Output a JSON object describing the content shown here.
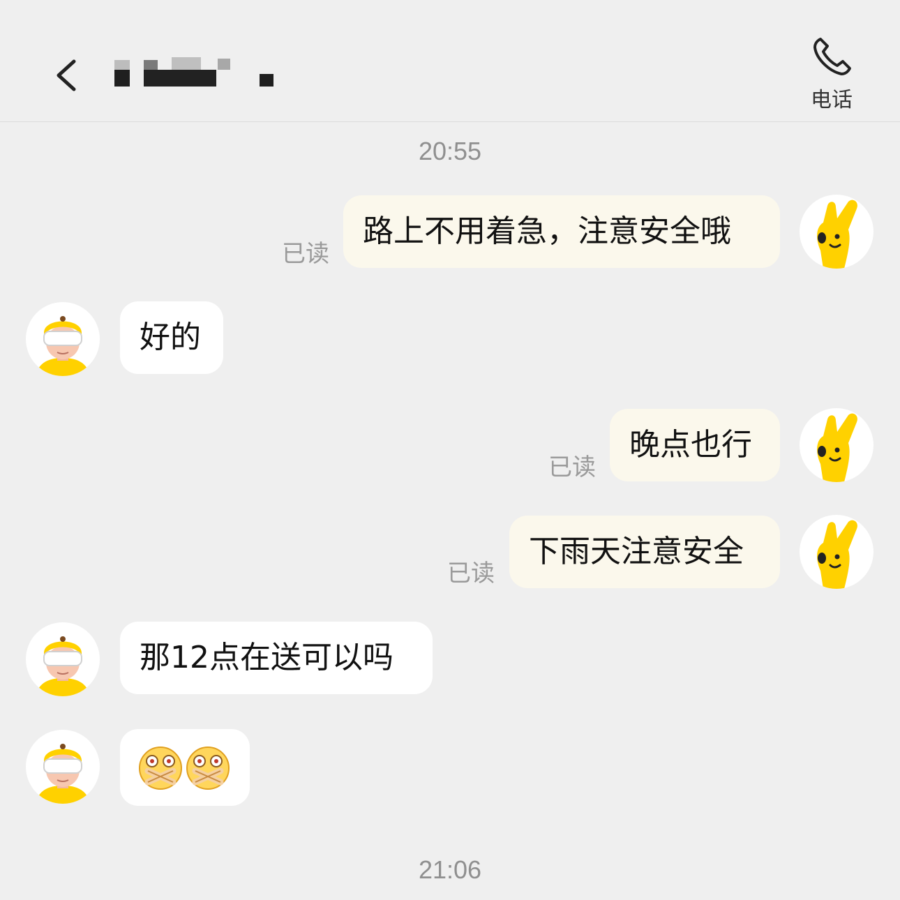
{
  "header": {
    "back_icon": "chevron-left-icon",
    "title_obscured": true,
    "call_icon": "phone-icon",
    "call_label": "电话"
  },
  "timestamps": [
    "20:55",
    "21:06"
  ],
  "messages": [
    {
      "side": "right",
      "text": "路上不用着急，注意安全哦",
      "status": "已读"
    },
    {
      "side": "left",
      "text": "好的"
    },
    {
      "side": "right",
      "text": "晚点也行",
      "status": "已读"
    },
    {
      "side": "right",
      "text": "下雨天注意安全",
      "status": "已读"
    },
    {
      "side": "left",
      "text": "那12点在送可以吗"
    },
    {
      "side": "left",
      "emoji": [
        "shocked-face-emoji",
        "shocked-face-emoji"
      ]
    }
  ],
  "colors": {
    "background": "#efefef",
    "outgoing_bubble": "#fbf8ec",
    "incoming_bubble": "#ffffff",
    "brand_yellow": "#ffd100"
  }
}
